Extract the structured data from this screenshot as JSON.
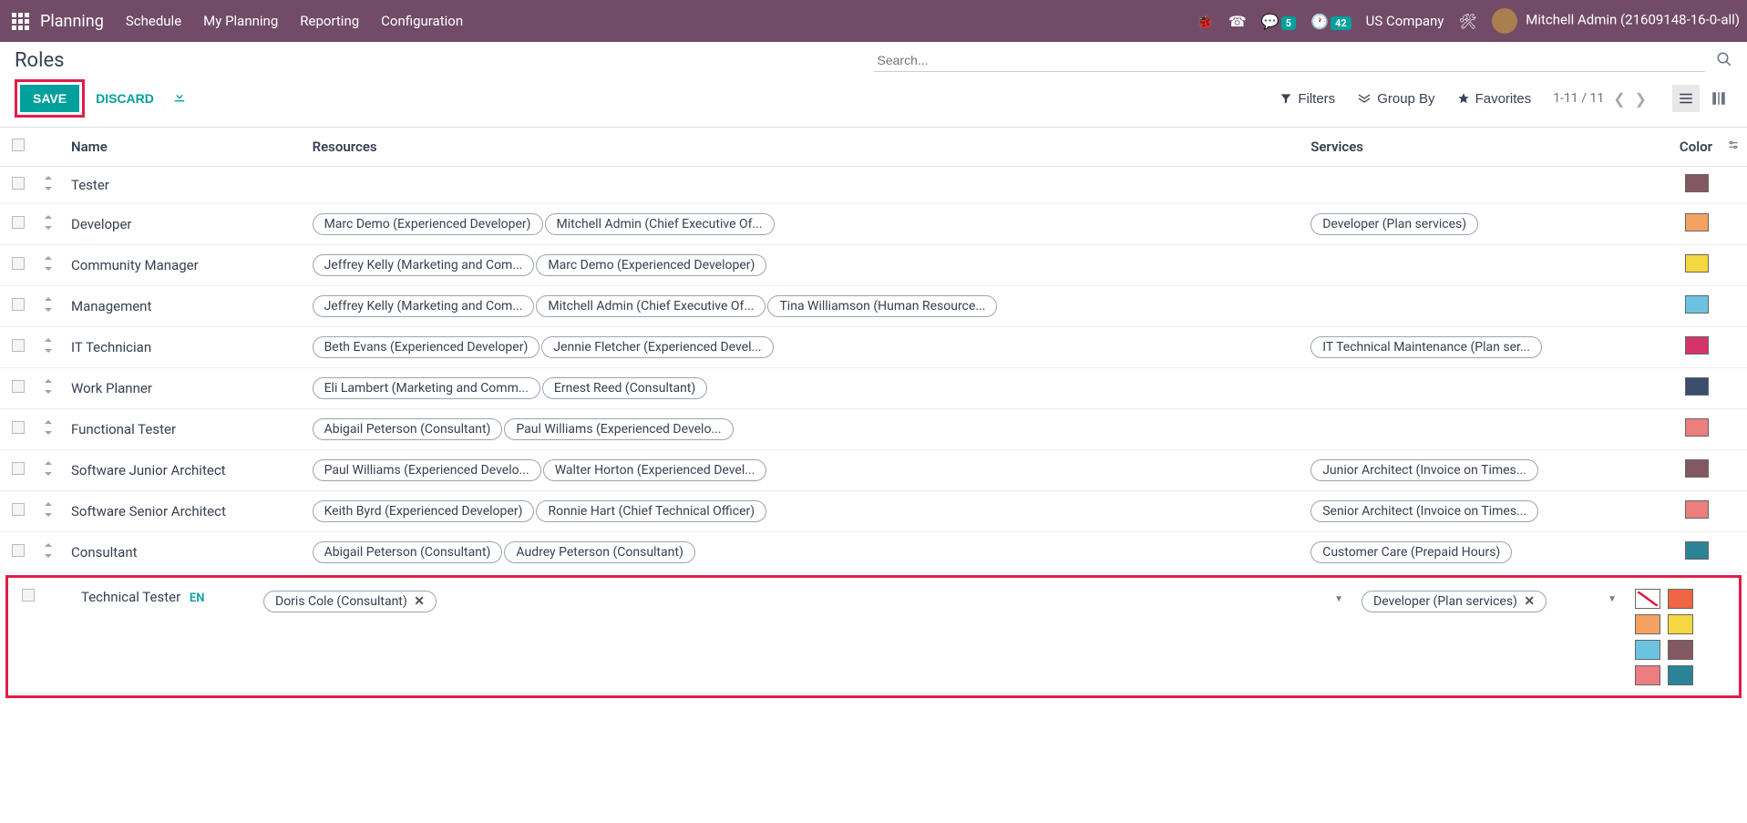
{
  "topbar": {
    "app_title": "Planning",
    "nav": [
      "Schedule",
      "My Planning",
      "Reporting",
      "Configuration"
    ],
    "msg_badge": "5",
    "activity_badge": "42",
    "company": "US Company",
    "user": "Mitchell Admin (21609148-16-0-all)"
  },
  "breadcrumb": "Roles",
  "search_placeholder": "Search...",
  "buttons": {
    "save": "SAVE",
    "discard": "DISCARD",
    "filters": "Filters",
    "groupby": "Group By",
    "favorites": "Favorites"
  },
  "pager": "1-11 / 11",
  "columns": {
    "name": "Name",
    "resources": "Resources",
    "services": "Services",
    "color": "Color"
  },
  "rows": [
    {
      "name": "Tester",
      "resources": [],
      "services": [],
      "color": "#845863"
    },
    {
      "name": "Developer",
      "resources": [
        "Marc Demo (Experienced Developer)",
        "Mitchell Admin (Chief Executive Of..."
      ],
      "services": [
        "Developer (Plan services)"
      ],
      "color": "#f4a261"
    },
    {
      "name": "Community Manager",
      "resources": [
        "Jeffrey Kelly (Marketing and Com...",
        "Marc Demo (Experienced Developer)"
      ],
      "services": [],
      "color": "#f5d742"
    },
    {
      "name": "Management",
      "resources": [
        "Jeffrey Kelly (Marketing and Com...",
        "Mitchell Admin (Chief Executive Of...",
        "Tina Williamson (Human Resource..."
      ],
      "services": [],
      "color": "#6cc3e0"
    },
    {
      "name": "IT Technician",
      "resources": [
        "Beth Evans (Experienced Developer)",
        "Jennie Fletcher (Experienced Devel..."
      ],
      "services": [
        "IT Technical Maintenance (Plan ser..."
      ],
      "color": "#d6336c"
    },
    {
      "name": "Work Planner",
      "resources": [
        "Eli Lambert (Marketing and Comm...",
        "Ernest Reed (Consultant)"
      ],
      "services": [],
      "color": "#3b4d6b"
    },
    {
      "name": "Functional Tester",
      "resources": [
        "Abigail Peterson (Consultant)",
        "Paul Williams (Experienced Develo..."
      ],
      "services": [],
      "color": "#eb7e7f"
    },
    {
      "name": "Software Junior Architect",
      "resources": [
        "Paul Williams (Experienced Develo...",
        "Walter Horton (Experienced Devel..."
      ],
      "services": [
        "Junior Architect (Invoice on Times..."
      ],
      "color": "#845863"
    },
    {
      "name": "Software Senior Architect",
      "resources": [
        "Keith Byrd (Experienced Developer)",
        "Ronnie Hart (Chief Technical Officer)"
      ],
      "services": [
        "Senior Architect (Invoice on Times..."
      ],
      "color": "#eb7e7f"
    },
    {
      "name": "Consultant",
      "resources": [
        "Abigail Peterson (Consultant)",
        "Audrey Peterson (Consultant)"
      ],
      "services": [
        "Customer Care (Prepaid Hours)"
      ],
      "color": "#2c8397"
    }
  ],
  "editing": {
    "name": "Technical Tester",
    "lang": "EN",
    "resources": [
      "Doris Cole (Consultant)"
    ],
    "services": [
      "Developer (Plan services)"
    ],
    "palette": [
      "none",
      "#f06543",
      "#f4a261",
      "#f5d742",
      "#6cc3e0",
      "#845863",
      "#eb7e7f",
      "#2c8397"
    ]
  }
}
